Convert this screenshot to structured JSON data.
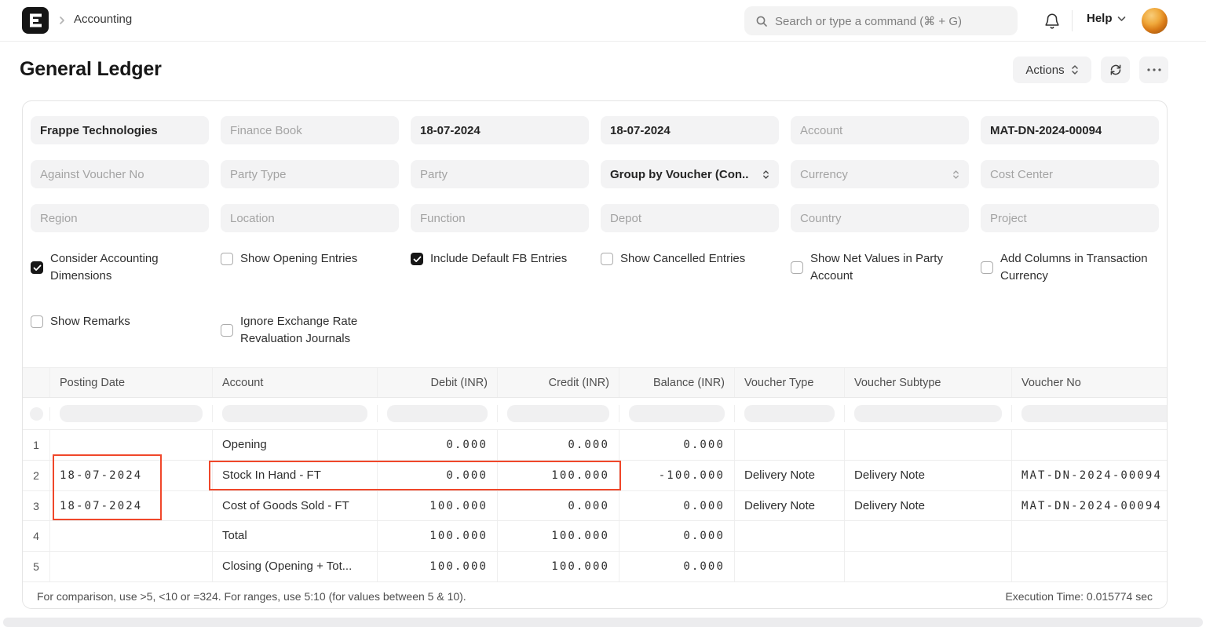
{
  "navbar": {
    "breadcrumb": "Accounting",
    "search_placeholder": "Search or type a command (⌘ + G)",
    "help_label": "Help"
  },
  "page_header": {
    "title": "General Ledger",
    "actions_label": "Actions"
  },
  "filters": [
    {
      "name": "company",
      "value": "Frappe Technologies"
    },
    {
      "name": "finance-book",
      "placeholder": "Finance Book"
    },
    {
      "name": "from-date",
      "value": "18-07-2024"
    },
    {
      "name": "to-date",
      "value": "18-07-2024"
    },
    {
      "name": "account",
      "placeholder": "Account"
    },
    {
      "name": "voucher-no",
      "value": "MAT-DN-2024-00094"
    },
    {
      "name": "against-voucher-no",
      "placeholder": "Against Voucher No"
    },
    {
      "name": "party-type",
      "placeholder": "Party Type"
    },
    {
      "name": "party",
      "placeholder": "Party"
    },
    {
      "name": "group-by",
      "value": "Group by Voucher (Con..",
      "select": true
    },
    {
      "name": "currency",
      "placeholder": "Currency",
      "select": true
    },
    {
      "name": "cost-center",
      "placeholder": "Cost Center"
    },
    {
      "name": "region",
      "placeholder": "Region"
    },
    {
      "name": "location",
      "placeholder": "Location"
    },
    {
      "name": "function",
      "placeholder": "Function"
    },
    {
      "name": "depot",
      "placeholder": "Depot"
    },
    {
      "name": "country",
      "placeholder": "Country"
    },
    {
      "name": "project",
      "placeholder": "Project"
    }
  ],
  "checkboxes": [
    {
      "name": "consider-accounting-dimensions",
      "label": "Consider Accounting Dimensions",
      "checked": true
    },
    {
      "name": "show-opening-entries",
      "label": "Show Opening Entries",
      "checked": false
    },
    {
      "name": "include-default-fb-entries",
      "label": "Include Default FB Entries",
      "checked": true
    },
    {
      "name": "show-cancelled-entries",
      "label": "Show Cancelled Entries",
      "checked": false
    },
    {
      "name": "show-net-values-in-party-account",
      "label": "Show Net Values in Party Account",
      "checked": false
    },
    {
      "name": "add-columns-in-transaction-currency",
      "label": "Add Columns in Transaction Currency",
      "checked": false
    },
    {
      "name": "show-remarks",
      "label": "Show Remarks",
      "checked": false
    },
    {
      "name": "ignore-exchange-rate-revaluation-journals",
      "label": "Ignore Exchange Rate Revaluation Journals",
      "checked": false
    }
  ],
  "table": {
    "columns": [
      {
        "label": "",
        "align": "left"
      },
      {
        "label": "Posting Date",
        "align": "left"
      },
      {
        "label": "Account",
        "align": "left"
      },
      {
        "label": "Debit (INR)",
        "align": "right"
      },
      {
        "label": "Credit (INR)",
        "align": "right"
      },
      {
        "label": "Balance (INR)",
        "align": "right"
      },
      {
        "label": "Voucher Type",
        "align": "left"
      },
      {
        "label": "Voucher Subtype",
        "align": "left"
      },
      {
        "label": "Voucher No",
        "align": "left"
      }
    ],
    "rows": [
      [
        "1",
        "",
        "Opening",
        "0.000",
        "0.000",
        "0.000",
        "",
        "",
        ""
      ],
      [
        "2",
        "18-07-2024",
        "Stock In Hand - FT",
        "0.000",
        "100.000",
        "-100.000",
        "Delivery Note",
        "Delivery Note",
        "MAT-DN-2024-00094"
      ],
      [
        "3",
        "18-07-2024",
        "Cost of Goods Sold - FT",
        "100.000",
        "0.000",
        "0.000",
        "Delivery Note",
        "Delivery Note",
        "MAT-DN-2024-00094"
      ],
      [
        "4",
        "",
        "Total",
        "100.000",
        "100.000",
        "0.000",
        "",
        "",
        ""
      ],
      [
        "5",
        "",
        "Closing (Opening + Tot...",
        "100.000",
        "100.000",
        "0.000",
        "",
        "",
        ""
      ]
    ]
  },
  "report_footer": {
    "hint": "For comparison, use >5, <10 or =324. For ranges, use 5:10 (for values between 5 & 10).",
    "execution_time": "Execution Time: 0.015774 sec"
  },
  "colors": {
    "highlight_red": "#f0472a",
    "checkbox_checked": "#171717"
  }
}
